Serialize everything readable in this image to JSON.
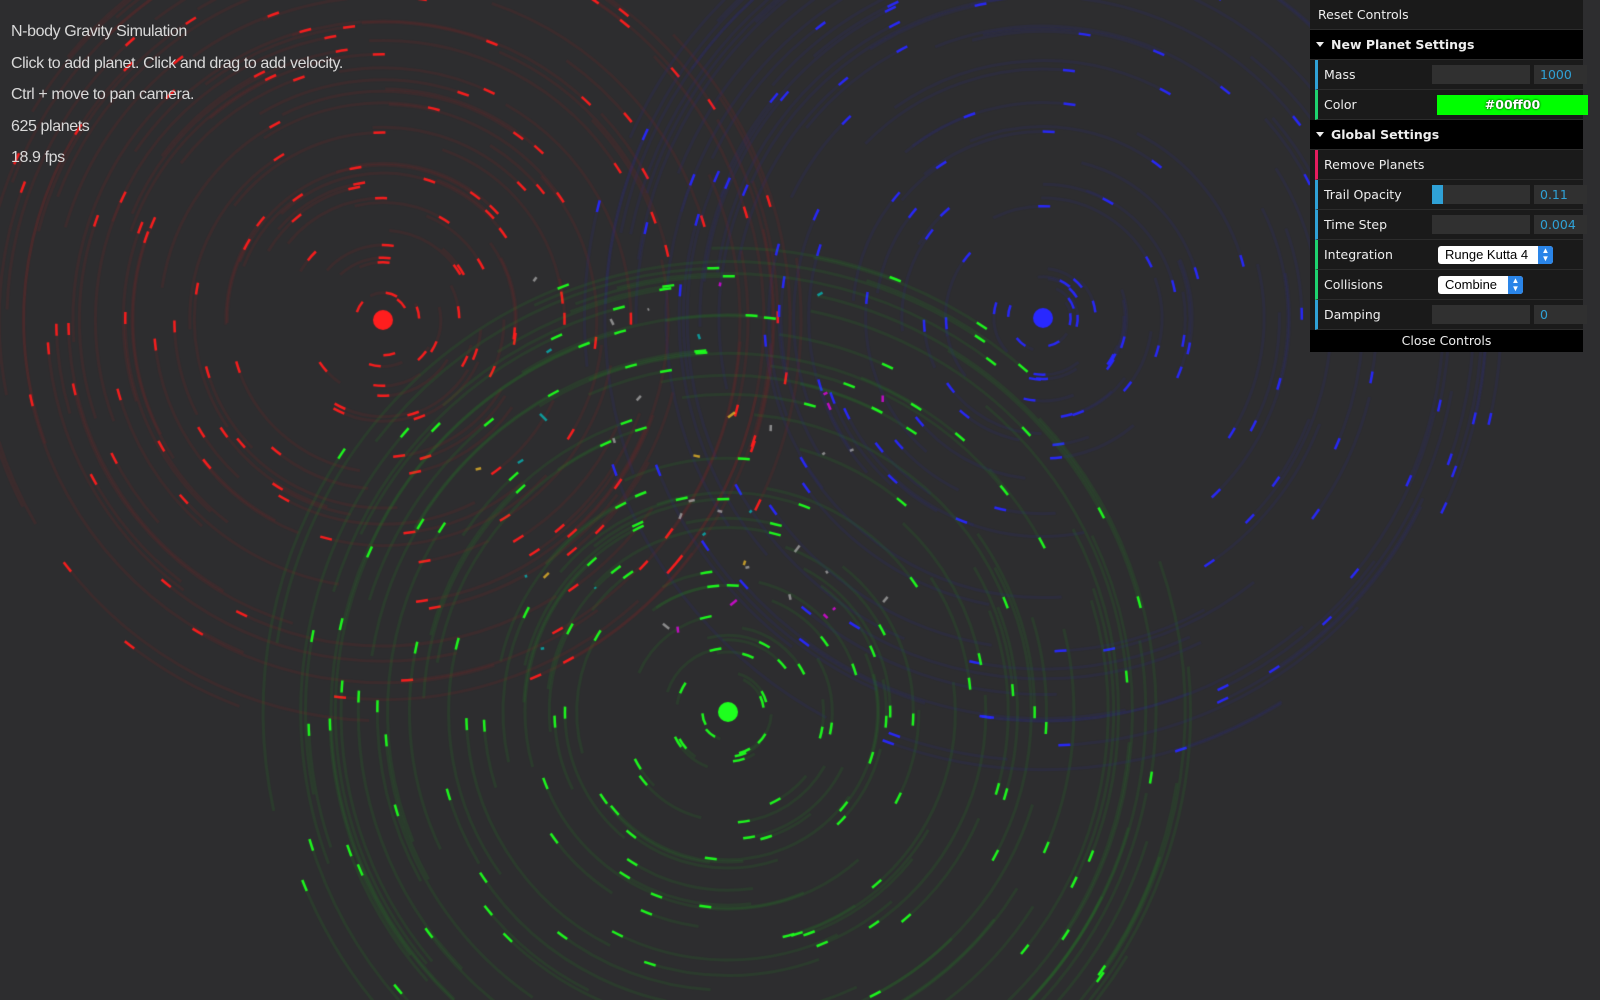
{
  "info": {
    "title": "N-body Gravity Simulation",
    "instructions_1": "Click to add planet. Click and drag to add velocity.",
    "instructions_2": "Ctrl + move to pan camera.",
    "planet_count": "625 planets",
    "fps": "18.9 fps"
  },
  "controls": {
    "reset_label": "Reset Controls",
    "new_planet": {
      "title": "New Planet Settings",
      "mass_label": "Mass",
      "mass_value": "1000",
      "color_label": "Color",
      "color_value": "#00ff00"
    },
    "global": {
      "title": "Global Settings",
      "remove_label": "Remove Planets",
      "trail_opacity_label": "Trail Opacity",
      "trail_opacity_value": "0.11",
      "trail_opacity_fraction": 0.11,
      "time_step_label": "Time Step",
      "time_step_value": "0.004",
      "integration_label": "Integration",
      "integration_value": "Runge Kutta 4",
      "collisions_label": "Collisions",
      "collisions_value": "Combine",
      "damping_label": "Damping",
      "damping_value": "0"
    },
    "close_label": "Close Controls"
  },
  "colors": {
    "background": "#2d2d2f",
    "red": "#ff1a1a",
    "green": "#00ff00",
    "blue": "#1a1aff"
  }
}
